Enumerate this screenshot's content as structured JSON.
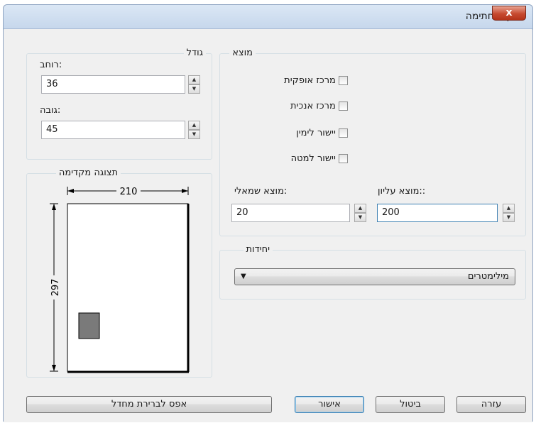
{
  "window": {
    "title": "מיקום חתימה",
    "close_glyph": "x"
  },
  "size_group": {
    "title": "גודל",
    "width_label": ":רוחב",
    "width_value": "36",
    "height_label": ":גובה",
    "height_value": "45"
  },
  "preview_group": {
    "title": "תצוגה מקדימה",
    "width_dim": "210",
    "height_dim": "297"
  },
  "position_group": {
    "title": "מוצא",
    "center_horizontal": "מרכז אופקית",
    "center_vertical": "מרכז אנכית",
    "align_right": "יישור לימין",
    "align_bottom": "יישור למטה",
    "left_offset_label": ":מוצא שמאלי",
    "left_offset_value": "20",
    "top_offset_label": "::מוצא עליון",
    "top_offset_value": "200"
  },
  "units_group": {
    "title": "יחידות",
    "selected": "מילימטרים"
  },
  "buttons": {
    "reset": "אפס לברירת מחדל",
    "ok": "אישור",
    "cancel": "ביטול",
    "help": "עזרה"
  },
  "colors": {
    "titlebar": "#c6d7ec",
    "close": "#c74a30",
    "focus": "#3c7fb1"
  }
}
